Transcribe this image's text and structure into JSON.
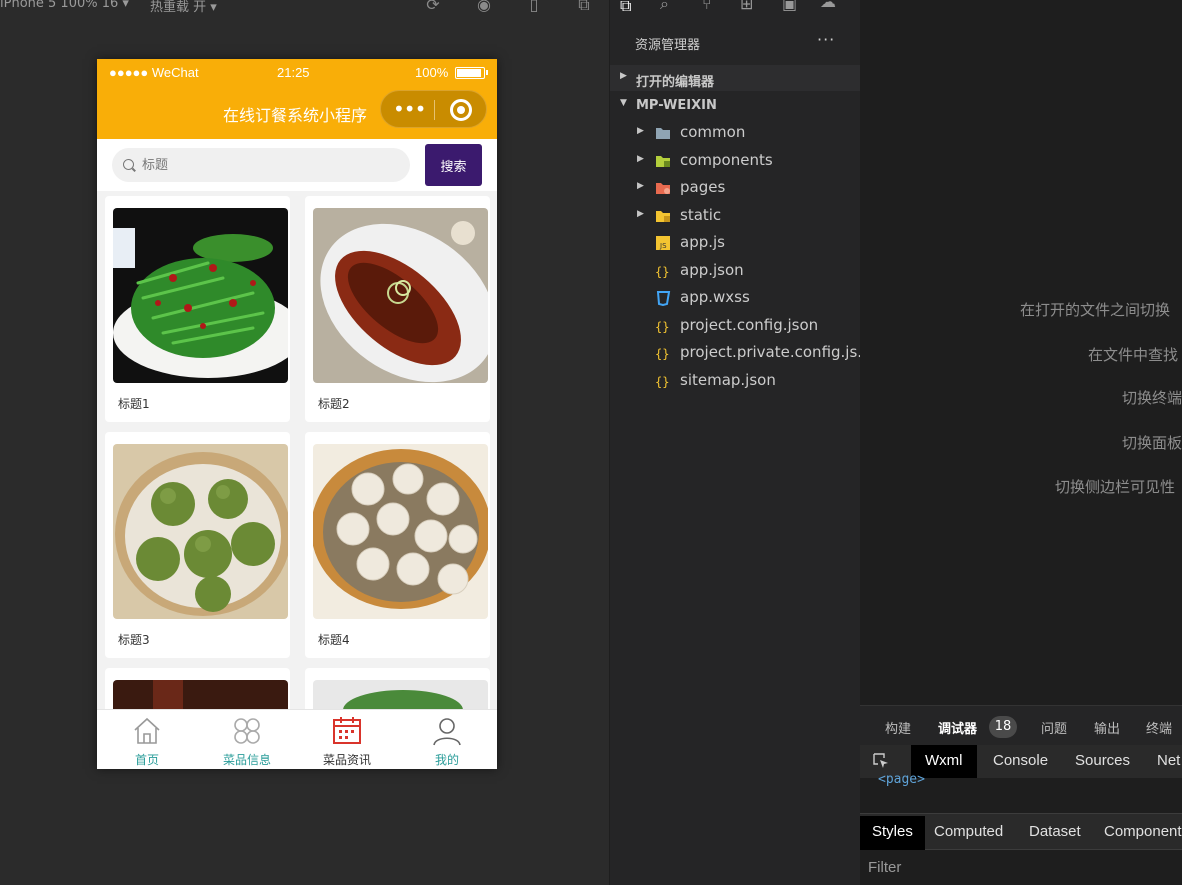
{
  "toolbar": {
    "device": "iPhone 5 100% 16 ▾",
    "reload_mode": "热重载 开 ▾"
  },
  "phone": {
    "status": {
      "carrier": "●●●●● WeChat",
      "time": "21:25",
      "battery": "100%"
    },
    "nav_title": "在线订餐系统小程序",
    "search": {
      "placeholder": "标题",
      "button": "搜索"
    },
    "cards": [
      {
        "label": "标题1"
      },
      {
        "label": "标题2"
      },
      {
        "label": "标题3"
      },
      {
        "label": "标题4"
      }
    ],
    "tabs": [
      {
        "label": "首页",
        "color": "#2a9d9a"
      },
      {
        "label": "菜品信息",
        "color": "#2a9d9a"
      },
      {
        "label": "菜品资讯",
        "color": "#333333"
      },
      {
        "label": "我的",
        "color": "#2a9d9a"
      }
    ],
    "accent": "#f9ae08",
    "button_color": "#3b1a6e"
  },
  "explorer": {
    "title": "资源管理器",
    "sections": [
      {
        "label": "打开的编辑器"
      },
      {
        "label": "MP-WEIXIN"
      }
    ],
    "files": [
      {
        "name": "common",
        "icon": "folder-icon"
      },
      {
        "name": "components",
        "icon": "components-folder-icon"
      },
      {
        "name": "pages",
        "icon": "pages-folder-icon"
      },
      {
        "name": "static",
        "icon": "static-folder-icon"
      },
      {
        "name": "app.js",
        "icon": "js-file-icon"
      },
      {
        "name": "app.json",
        "icon": "json-file-icon"
      },
      {
        "name": "app.wxss",
        "icon": "css-file-icon"
      },
      {
        "name": "project.config.json",
        "icon": "json-file-icon"
      },
      {
        "name": "project.private.config.js...",
        "icon": "json-file-icon"
      },
      {
        "name": "sitemap.json",
        "icon": "json-file-icon"
      }
    ]
  },
  "hints": [
    "在打开的文件之间切换",
    "在文件中查找",
    "切换终端",
    "切换面板",
    "切换侧边栏可见性"
  ],
  "debug": {
    "tabs": [
      "构建",
      "调试器",
      "问题",
      "输出",
      "终端"
    ],
    "badge": "18",
    "devtools_tabs": [
      "Wxml",
      "Console",
      "Sources",
      "Net"
    ],
    "wxml_code": "<page>",
    "style_tabs": [
      "Styles",
      "Computed",
      "Dataset",
      "Component"
    ],
    "filter_placeholder": "Filter"
  }
}
